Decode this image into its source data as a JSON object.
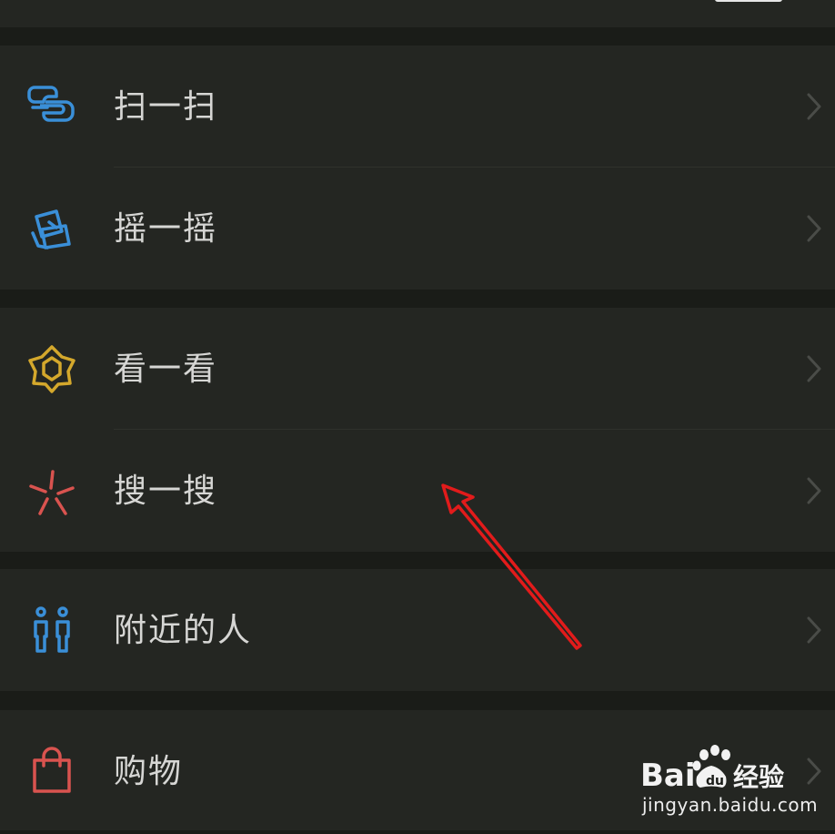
{
  "menu": {
    "items": [
      {
        "label": "扫一扫",
        "icon": "scan-icon"
      },
      {
        "label": "摇一摇",
        "icon": "shake-icon"
      },
      {
        "label": "看一看",
        "icon": "top-stories-icon"
      },
      {
        "label": "搜一搜",
        "icon": "search-icon"
      },
      {
        "label": "附近的人",
        "icon": "people-nearby-icon"
      },
      {
        "label": "购物",
        "icon": "shopping-bag-icon"
      }
    ]
  },
  "watermark": {
    "brand": "Bai 经验",
    "url": "jingyan.baidu.com"
  },
  "colors": {
    "background": "#1a1c18",
    "cell": "#242622",
    "text": "#d6d6d4",
    "scan_icon": "#3a8fd8",
    "top_stories_icon": "#d4a82c",
    "search_icon": "#d9534f",
    "people_icon": "#3a8fd8",
    "shopping_icon": "#d9534f",
    "annotation_arrow": "#e21b1b"
  }
}
